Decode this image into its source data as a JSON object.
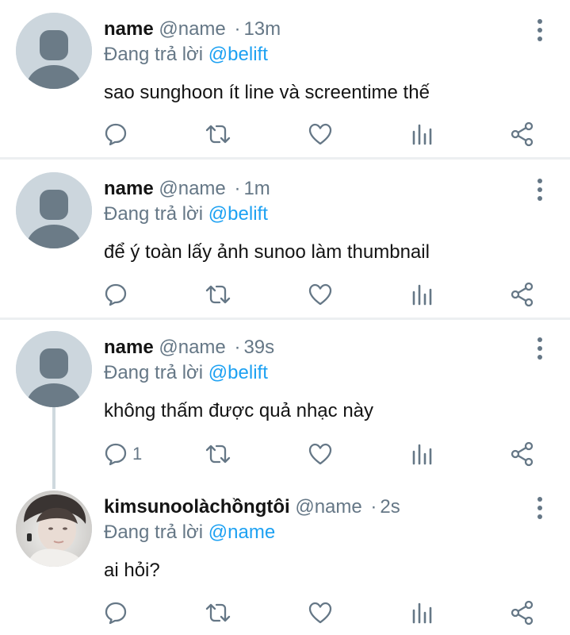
{
  "reply_prefix": "Đang trả lời",
  "colors": {
    "muted": "#657786",
    "mention": "#1da1f2",
    "separator": "#eceff1",
    "avatar_placeholder": "#ccd6dd",
    "avatar_silhouette": "#6b7b87"
  },
  "icons": [
    "more-vertical-icon",
    "comment-icon",
    "retweet-icon",
    "like-icon",
    "analytics-icon",
    "share-icon"
  ],
  "tweets": [
    {
      "display_name": "name",
      "handle": "@name",
      "separator": "·",
      "time": "13m",
      "reply_to": "@belift",
      "text": "sao sunghoon ít line và screentime thế",
      "reply_count": ""
    },
    {
      "display_name": "name",
      "handle": "@name",
      "separator": "·",
      "time": "1m",
      "reply_to": "@belift",
      "text": "để ý toàn lấy ảnh sunoo làm thumbnail",
      "reply_count": ""
    },
    {
      "display_name": "name",
      "handle": "@name",
      "separator": "·",
      "time": "39s",
      "reply_to": "@belift",
      "text": "không thấm được quả nhạc này",
      "reply_count": "1"
    },
    {
      "display_name": "kimsunoolàchồngtôi",
      "handle": "@name",
      "separator": "·",
      "time": "2s",
      "reply_to": "@name",
      "text": "ai hỏi?",
      "reply_count": ""
    }
  ]
}
